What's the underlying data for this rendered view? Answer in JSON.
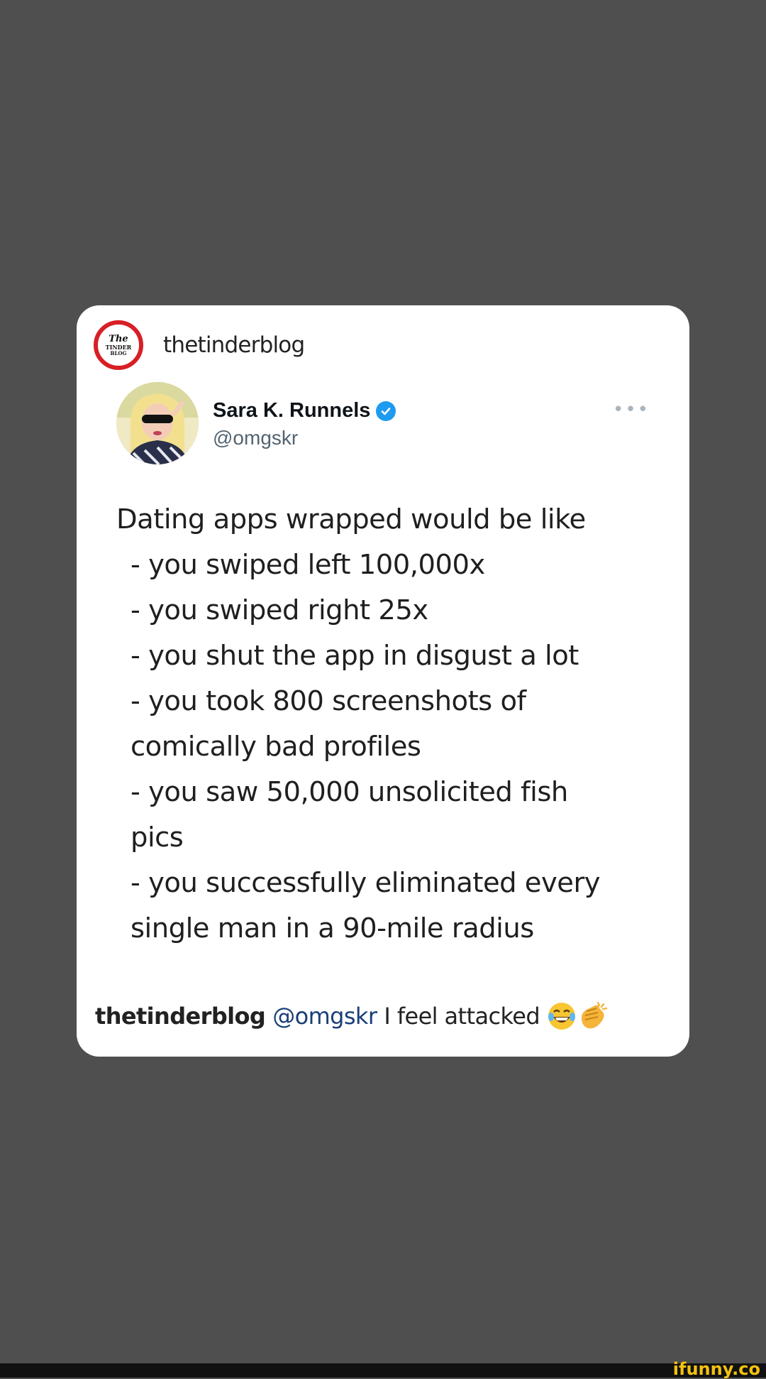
{
  "post": {
    "account": "thetinderblog",
    "logo_lines": [
      "The",
      "TINDER",
      "BLOG"
    ]
  },
  "tweet": {
    "display_name": "Sara K. Runnels",
    "handle": "@omgskr",
    "more": "•••",
    "lines": [
      "Dating apps wrapped would be like",
      "- you swiped left 100,000x",
      "- you swiped right 25x",
      "- you shut the app in disgust a lot",
      "- you took 800 screenshots of",
      "comically bad profiles",
      "- you saw 50,000 unsolicited fish",
      "pics",
      "- you successfully eliminated every",
      "single man in a 90-mile radius"
    ]
  },
  "caption": {
    "user": "thetinderblog",
    "mention": "@omgskr",
    "text": "I feel attacked"
  },
  "watermark": "ifunny.co",
  "colors": {
    "background": "#4f4f4f",
    "logo_ring": "#d81f26",
    "verified": "#1d9bf0",
    "mention": "#1a3f78",
    "watermark": "#f4c20d"
  }
}
